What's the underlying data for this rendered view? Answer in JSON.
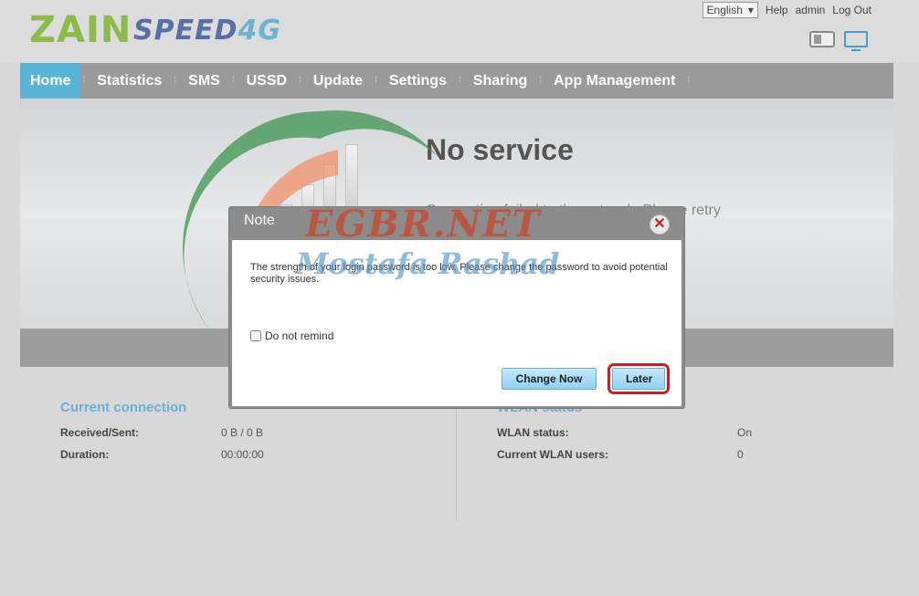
{
  "header": {
    "logo_zain": "ZAIN",
    "logo_speed": "SPEED",
    "logo_4g": "4G",
    "language": "English",
    "help": "Help",
    "user": "admin",
    "logout": "Log Out"
  },
  "nav": {
    "items": [
      "Home",
      "Statistics",
      "SMS",
      "USSD",
      "Update",
      "Settings",
      "Sharing",
      "App Management"
    ],
    "active": "Home"
  },
  "banner": {
    "title": "No service",
    "message": "Connection failed to the network. Please retry or select another network"
  },
  "current_connection": {
    "heading": "Current connection",
    "received_sent_label": "Received/Sent:",
    "received_sent_value": "0 B /  0 B",
    "duration_label": "Duration:",
    "duration_value": "00:00:00"
  },
  "wlan": {
    "heading": "WLAN status",
    "status_label": "WLAN status:",
    "status_value": "On",
    "users_label": "Current WLAN users:",
    "users_value": "0"
  },
  "dialog": {
    "title": "Note",
    "message": "The strength of your login password is too low. Please change the password to avoid potential security issues.",
    "remind_label": "Do not remind",
    "change_now": "Change Now",
    "later": "Later"
  },
  "watermark": {
    "line1": "EGBR.NET",
    "line2": "Mostafa Rashad"
  },
  "colors": {
    "accent": "#5ab4d6",
    "nav_bg": "#9a9a9a",
    "highlight": "#d01c1c",
    "zain_green": "#8dbb4a"
  }
}
